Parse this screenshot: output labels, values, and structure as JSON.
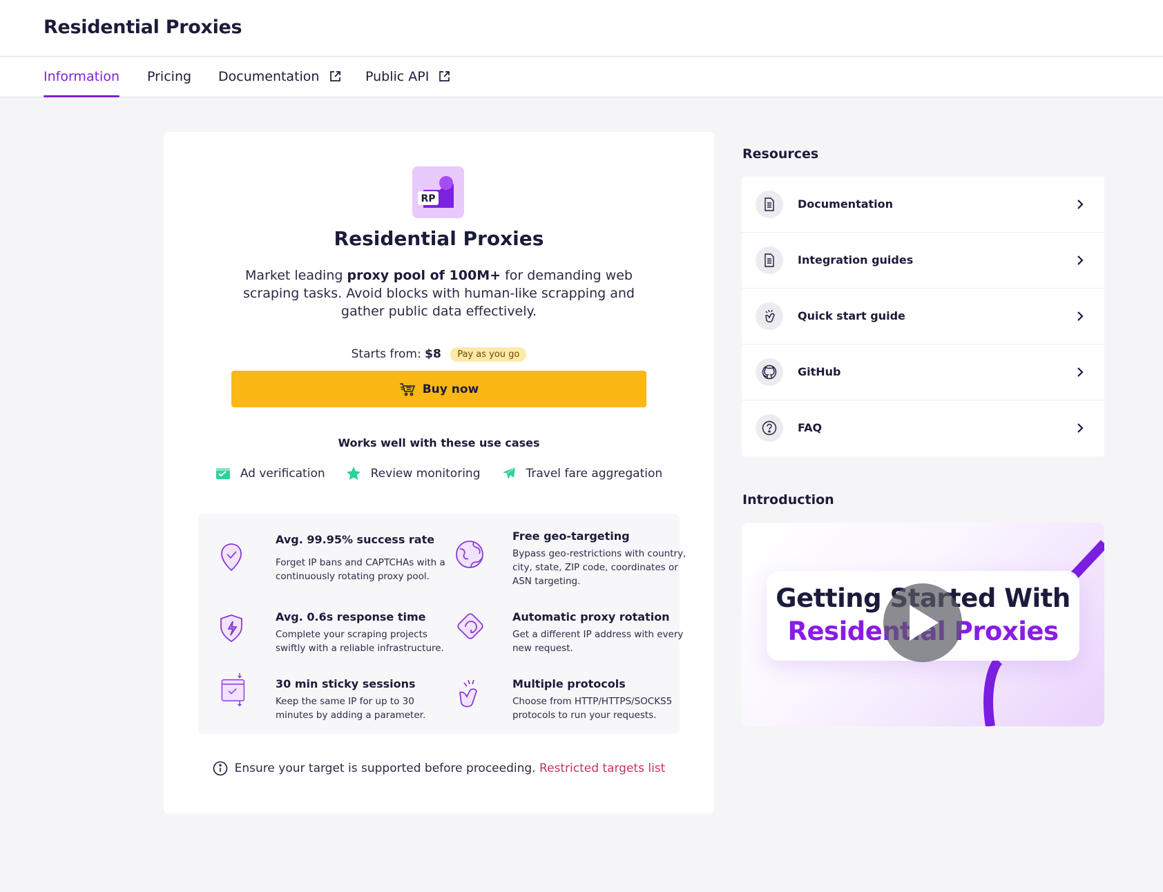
{
  "header": {
    "title": "Residential Proxies"
  },
  "tabs": [
    {
      "label": "Information",
      "active": true,
      "external": false
    },
    {
      "label": "Pricing",
      "active": false,
      "external": false
    },
    {
      "label": "Documentation",
      "active": false,
      "external": true
    },
    {
      "label": "Public API",
      "active": false,
      "external": true
    }
  ],
  "product": {
    "logo_text": "RP",
    "title": "Residential Proxies",
    "description_pre": "Market leading ",
    "description_bold": "proxy pool of 100M+",
    "description_post": " for demanding web scraping tasks. Avoid blocks with human-like scrapping and gather public data effectively.",
    "price_label": "Starts from:",
    "price_value": "$8",
    "price_badge": "Pay as you go",
    "buy_label": "Buy now"
  },
  "use_cases": {
    "title": "Works well with these use cases",
    "items": [
      {
        "label": "Ad verification",
        "icon": "ad-verification-icon"
      },
      {
        "label": "Review monitoring",
        "icon": "star-icon"
      },
      {
        "label": "Travel fare aggregation",
        "icon": "airplane-icon"
      }
    ]
  },
  "features": [
    {
      "title": "Avg. 99.95% success rate",
      "text": "Forget IP bans and CAPTCHAs with a continuously rotating proxy pool.",
      "icon": "shield-check-icon"
    },
    {
      "title": "Free geo-targeting",
      "text": "Bypass geo-restrictions with country, city, state, ZIP code, coordinates or ASN targeting.",
      "icon": "globe-icon"
    },
    {
      "title": "Avg. 0.6s response time",
      "text": "Complete your scraping projects swiftly with a reliable infrastructure.",
      "icon": "shield-lightning-icon"
    },
    {
      "title": "Automatic proxy rotation",
      "text": "Get a different IP address with every new request.",
      "icon": "rotation-icon"
    },
    {
      "title": "30 min sticky sessions",
      "text": "Keep the same IP for up to 30 minutes by adding a parameter.",
      "icon": "sticky-session-icon"
    },
    {
      "title": "Multiple protocols",
      "text": "Choose from HTTP/HTTPS/SOCKS5 protocols to run your requests.",
      "icon": "protocols-icon"
    }
  ],
  "notice": {
    "text": "Ensure your target is supported before proceeding.",
    "link": "Restricted targets list"
  },
  "resources": {
    "title": "Resources",
    "items": [
      {
        "label": "Documentation",
        "icon": "document-icon"
      },
      {
        "label": "Integration guides",
        "icon": "document-icon"
      },
      {
        "label": "Quick start guide",
        "icon": "hand-wave-icon"
      },
      {
        "label": "GitHub",
        "icon": "github-icon"
      },
      {
        "label": "FAQ",
        "icon": "question-icon"
      }
    ]
  },
  "introduction": {
    "title": "Introduction",
    "video_line1": "Getting Started With",
    "video_line2": "Residential Proxies"
  },
  "colors": {
    "accent": "#7c22d6",
    "buy_button": "#fbb713",
    "badge_bg": "#fde9a8",
    "link": "#c2335c",
    "use_case_green": "#2fd19a"
  }
}
